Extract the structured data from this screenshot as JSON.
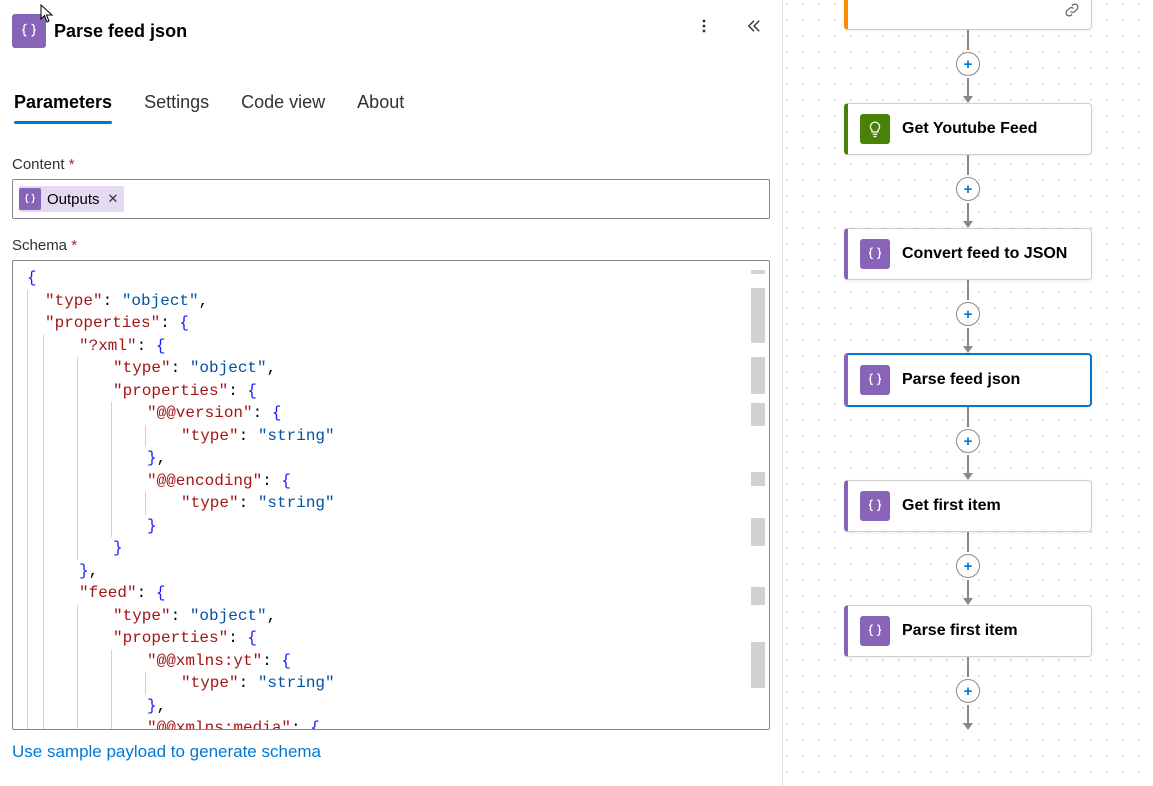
{
  "panel": {
    "title": "Parse feed json",
    "cursor_visible": true
  },
  "tabs": [
    {
      "key": "parameters",
      "label": "Parameters",
      "active": true
    },
    {
      "key": "settings",
      "label": "Settings",
      "active": false
    },
    {
      "key": "codeview",
      "label": "Code view",
      "active": false
    },
    {
      "key": "about",
      "label": "About",
      "active": false
    }
  ],
  "fields": {
    "content": {
      "label": "Content",
      "required": true,
      "token": {
        "text": "Outputs",
        "removable": true
      }
    },
    "schema": {
      "label": "Schema",
      "required": true,
      "code_lines": [
        [
          [
            "brace",
            "{"
          ]
        ],
        [
          [
            "ind",
            1
          ],
          [
            "key",
            "\"type\""
          ],
          [
            "punct",
            ": "
          ],
          [
            "str",
            "\"object\""
          ],
          [
            "punct",
            ","
          ]
        ],
        [
          [
            "ind",
            1
          ],
          [
            "key",
            "\"properties\""
          ],
          [
            "punct",
            ": "
          ],
          [
            "brace",
            "{"
          ]
        ],
        [
          [
            "ind",
            2
          ],
          [
            "key",
            "\"?xml\""
          ],
          [
            "punct",
            ": "
          ],
          [
            "brace",
            "{"
          ]
        ],
        [
          [
            "ind",
            3
          ],
          [
            "key",
            "\"type\""
          ],
          [
            "punct",
            ": "
          ],
          [
            "str",
            "\"object\""
          ],
          [
            "punct",
            ","
          ]
        ],
        [
          [
            "ind",
            3
          ],
          [
            "key",
            "\"properties\""
          ],
          [
            "punct",
            ": "
          ],
          [
            "brace",
            "{"
          ]
        ],
        [
          [
            "ind",
            4
          ],
          [
            "key",
            "\"@@version\""
          ],
          [
            "punct",
            ": "
          ],
          [
            "brace",
            "{"
          ]
        ],
        [
          [
            "ind",
            5
          ],
          [
            "key",
            "\"type\""
          ],
          [
            "punct",
            ": "
          ],
          [
            "str",
            "\"string\""
          ]
        ],
        [
          [
            "ind",
            4
          ],
          [
            "brace",
            "}"
          ],
          [
            "punct",
            ","
          ]
        ],
        [
          [
            "ind",
            4
          ],
          [
            "key",
            "\"@@encoding\""
          ],
          [
            "punct",
            ": "
          ],
          [
            "brace",
            "{"
          ]
        ],
        [
          [
            "ind",
            5
          ],
          [
            "key",
            "\"type\""
          ],
          [
            "punct",
            ": "
          ],
          [
            "str",
            "\"string\""
          ]
        ],
        [
          [
            "ind",
            4
          ],
          [
            "brace",
            "}"
          ]
        ],
        [
          [
            "ind",
            3
          ],
          [
            "brace",
            "}"
          ]
        ],
        [
          [
            "ind",
            2
          ],
          [
            "brace",
            "}"
          ],
          [
            "punct",
            ","
          ]
        ],
        [
          [
            "ind",
            2
          ],
          [
            "key",
            "\"feed\""
          ],
          [
            "punct",
            ": "
          ],
          [
            "brace",
            "{"
          ]
        ],
        [
          [
            "ind",
            3
          ],
          [
            "key",
            "\"type\""
          ],
          [
            "punct",
            ": "
          ],
          [
            "str",
            "\"object\""
          ],
          [
            "punct",
            ","
          ]
        ],
        [
          [
            "ind",
            3
          ],
          [
            "key",
            "\"properties\""
          ],
          [
            "punct",
            ": "
          ],
          [
            "brace",
            "{"
          ]
        ],
        [
          [
            "ind",
            4
          ],
          [
            "key",
            "\"@@xmlns:yt\""
          ],
          [
            "punct",
            ": "
          ],
          [
            "brace",
            "{"
          ]
        ],
        [
          [
            "ind",
            5
          ],
          [
            "key",
            "\"type\""
          ],
          [
            "punct",
            ": "
          ],
          [
            "str",
            "\"string\""
          ]
        ],
        [
          [
            "ind",
            4
          ],
          [
            "brace",
            "}"
          ],
          [
            "punct",
            ","
          ]
        ],
        [
          [
            "ind",
            4
          ],
          [
            "key",
            "\"@@xmlns:media\""
          ],
          [
            "punct",
            ": "
          ],
          [
            "brace",
            "{"
          ]
        ]
      ]
    },
    "generate_link": "Use sample payload to generate schema"
  },
  "icons": {
    "action": "braces-icon",
    "token": "braces-icon",
    "more": "more-vertical-icon",
    "collapse": "chevron-double-left-icon",
    "chain": "link-icon"
  },
  "flow": {
    "trigger_partial": {
      "icon": "link-icon"
    },
    "nodes": [
      {
        "id": "get-youtube-feed",
        "label": "Get Youtube Feed",
        "color": "green",
        "selected": false
      },
      {
        "id": "convert-feed-json",
        "label": "Convert feed to JSON",
        "color": "purple",
        "selected": false
      },
      {
        "id": "parse-feed-json",
        "label": "Parse feed json",
        "color": "purple",
        "selected": true
      },
      {
        "id": "get-first-item",
        "label": "Get first item",
        "color": "purple",
        "selected": false
      },
      {
        "id": "parse-first-item",
        "label": "Parse first item",
        "color": "purple",
        "selected": false
      }
    ],
    "add_label": "+"
  }
}
